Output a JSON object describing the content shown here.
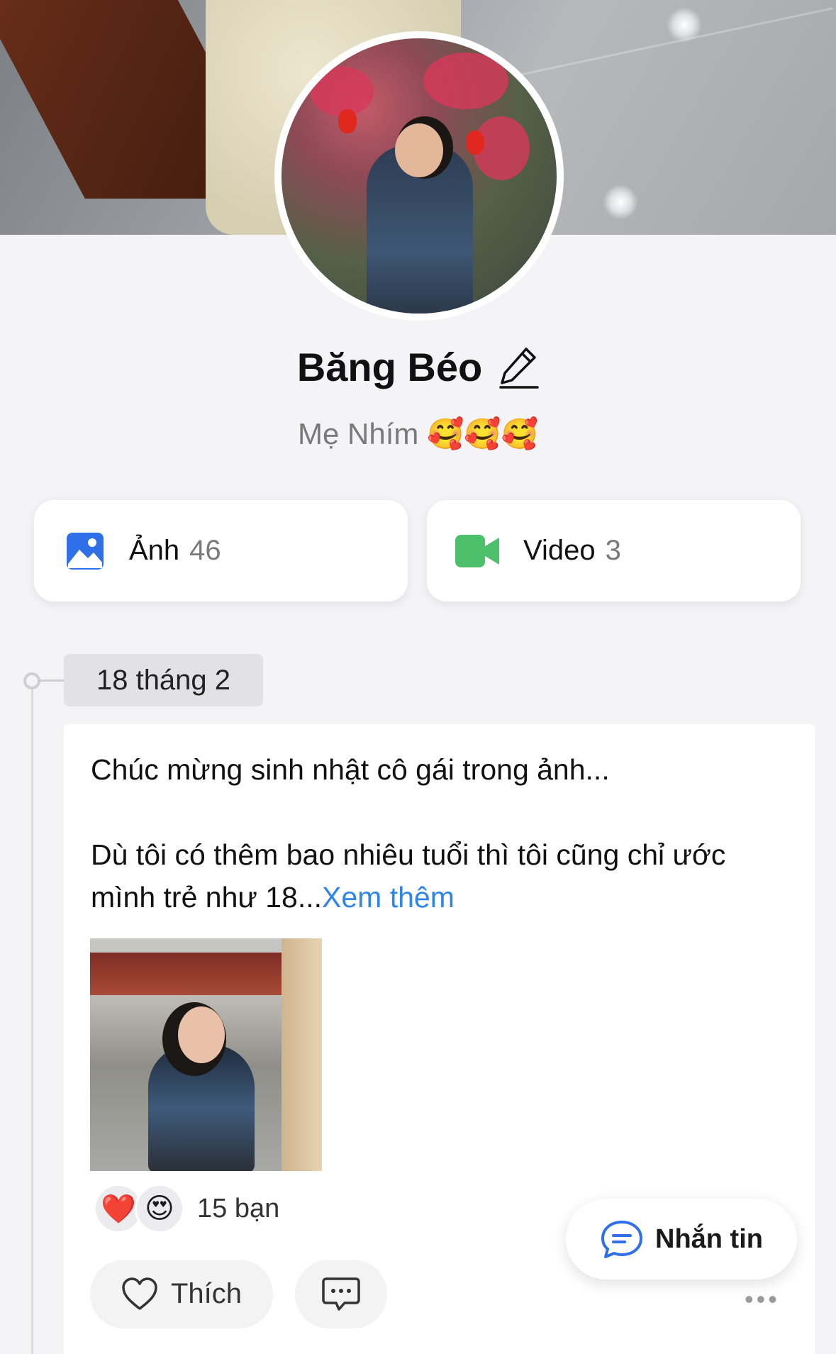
{
  "profile": {
    "name": "Băng Béo",
    "subtitle": "Mẹ Nhím 🥰🥰🥰"
  },
  "media": {
    "photos_label": "Ảnh",
    "photos_count": "46",
    "videos_label": "Video",
    "videos_count": "3"
  },
  "timeline": {
    "date": "18 tháng 2"
  },
  "post": {
    "line1": "Chúc mừng sinh nhật cô gái trong ảnh...",
    "line2": "Dù tôi có thêm bao nhiêu tuổi thì tôi cũng chỉ ước",
    "line3": "mình trẻ như 18...",
    "see_more": "Xem thêm",
    "reaction_1": "❤️",
    "reaction_2": "😍",
    "reaction_count": "15 bạn",
    "like_label": "Thích",
    "more": "•••"
  },
  "chat": {
    "label": "Nhắn tin"
  },
  "colors": {
    "accent_blue": "#2f86e8",
    "photo_icon_blue": "#2f6fe8",
    "video_icon_green": "#4cc06a"
  }
}
